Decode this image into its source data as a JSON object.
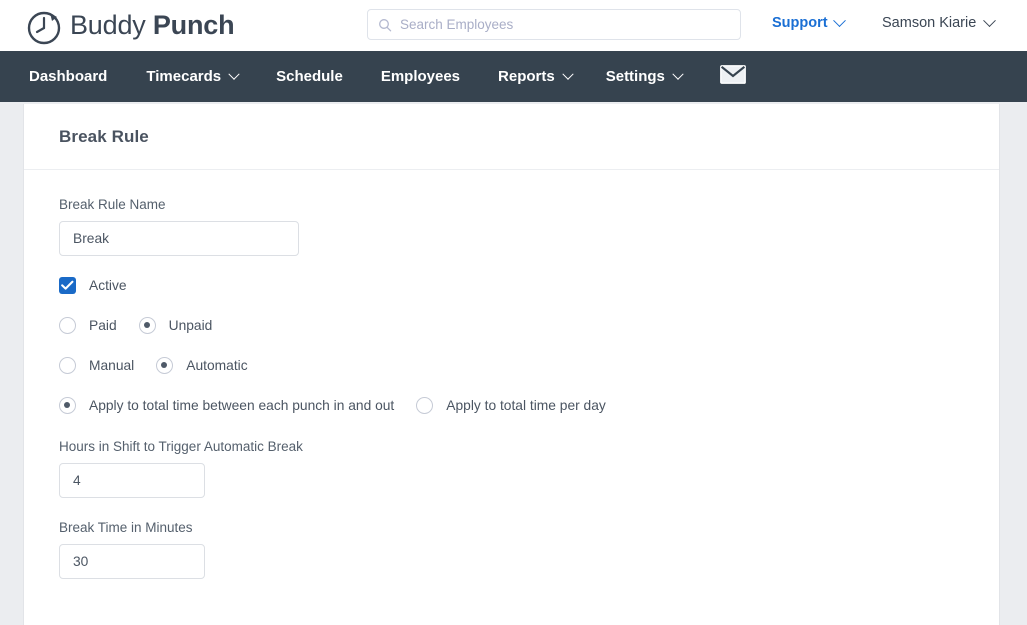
{
  "brand": {
    "name_light": "Buddy",
    "name_bold": "Punch",
    "logo_icon": "clock-logo-icon",
    "nav_bg": "#36434f",
    "accent_blue": "#1a6fd4",
    "checkbox_blue": "#1a6ac7"
  },
  "header": {
    "search": {
      "icon": "search-icon",
      "placeholder": "Search Employees",
      "value": ""
    },
    "support_label": "Support",
    "user_name": "Samson Kiarie"
  },
  "nav": {
    "items": [
      {
        "label": "Dashboard",
        "has_caret": false,
        "active": false
      },
      {
        "label": "Timecards",
        "has_caret": true,
        "active": false
      },
      {
        "label": "Schedule",
        "has_caret": false,
        "active": false
      },
      {
        "label": "Employees",
        "has_caret": false,
        "active": false
      },
      {
        "label": "Reports",
        "has_caret": true,
        "active": false
      },
      {
        "label": "Settings",
        "has_caret": true,
        "active": true
      }
    ],
    "mail_icon": "envelope-icon"
  },
  "page": {
    "title": "Break Rule",
    "fields": {
      "break_rule_name": {
        "label": "Break Rule Name",
        "value": "Break"
      },
      "hours_trigger": {
        "label": "Hours in Shift to Trigger Automatic Break",
        "value": "4"
      },
      "break_minutes": {
        "label": "Break Time in Minutes",
        "value": "30"
      }
    },
    "active_checkbox": {
      "label": "Active",
      "checked": true
    },
    "pay_group": {
      "options": [
        {
          "label": "Paid",
          "selected": false
        },
        {
          "label": "Unpaid",
          "selected": true
        }
      ]
    },
    "mode_group": {
      "options": [
        {
          "label": "Manual",
          "selected": false
        },
        {
          "label": "Automatic",
          "selected": true
        }
      ]
    },
    "apply_group": {
      "options": [
        {
          "label": "Apply to total time between each punch in and out",
          "selected": true
        },
        {
          "label": "Apply to total time per day",
          "selected": false
        }
      ]
    }
  }
}
